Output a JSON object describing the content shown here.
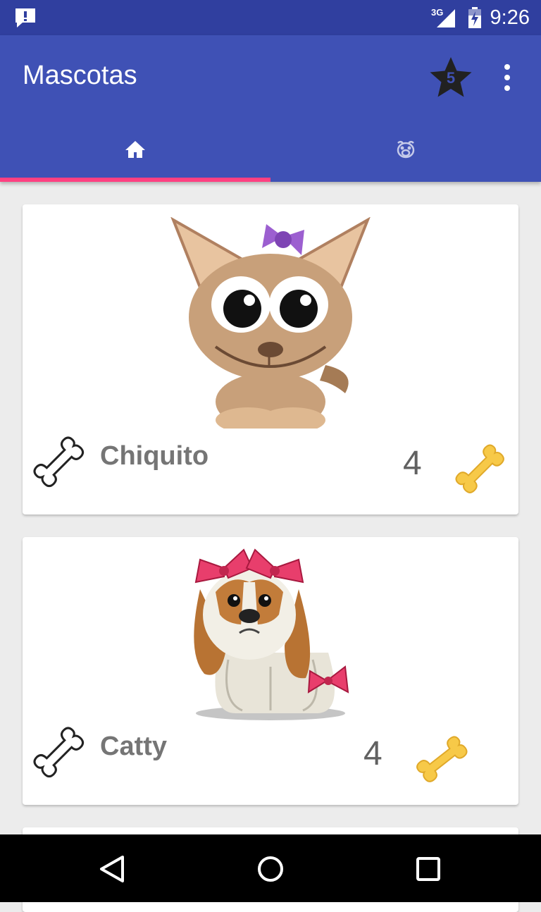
{
  "status_bar": {
    "network": "3G",
    "time": "9:26"
  },
  "app_bar": {
    "title": "Mascotas",
    "favorites_count": "5"
  },
  "tabs": [
    {
      "icon": "home-icon",
      "selected": true
    },
    {
      "icon": "pet-icon",
      "selected": false
    }
  ],
  "pets": [
    {
      "name": "Chiquito",
      "rating": "4"
    },
    {
      "name": "Catty",
      "rating": "4"
    }
  ],
  "colors": {
    "primary": "#3f51b5",
    "primary_dark": "#303f9f",
    "accent": "#ff4081",
    "bone_gold": "#f7c948"
  }
}
